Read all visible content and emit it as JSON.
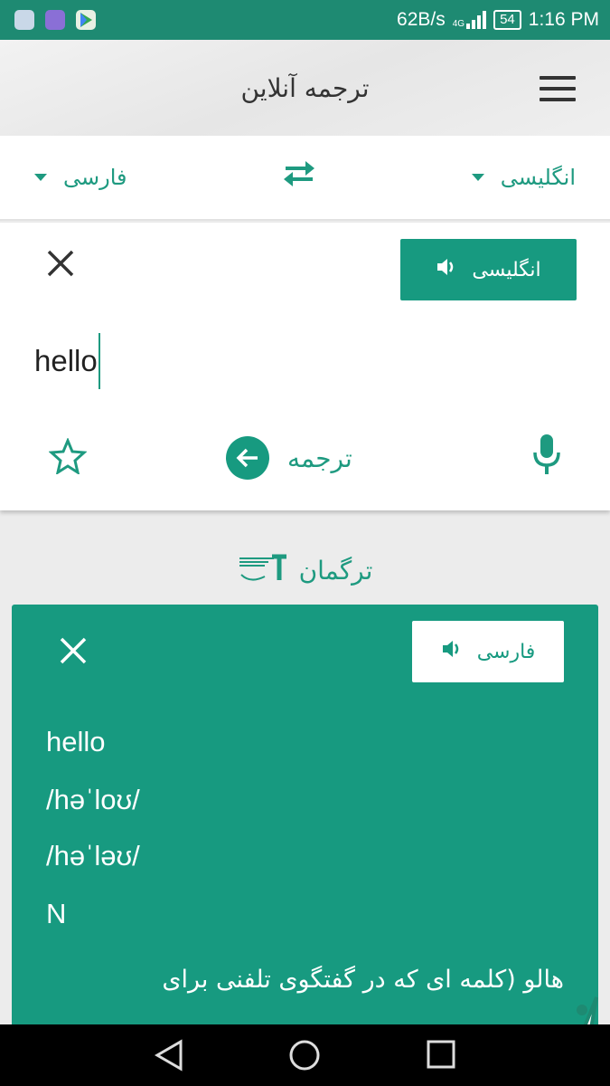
{
  "status_bar": {
    "net_speed": "62B/s",
    "network_type": "4G",
    "battery": "54",
    "time": "1:16 PM"
  },
  "header": {
    "title": "ترجمه آنلاین",
    "menu_icon": "hamburger-menu-icon"
  },
  "language_bar": {
    "left_language": "فارسی",
    "right_language": "انگلیسی",
    "swap_icon": "swap-arrows-icon"
  },
  "input_card": {
    "source_language_button": "انگلیسی",
    "input_text": "hello",
    "translate_label": "ترجمه"
  },
  "brand": {
    "name": "ترگمان"
  },
  "result_card": {
    "target_language_button": "فارسی",
    "lines": [
      "hello",
      "/həˈloʊ/",
      "/həˈləʊ/",
      "N"
    ],
    "persian_text": "هالو (کلمه ای که در گفتگوی تلفنی برای"
  },
  "colors": {
    "accent": "#179a80",
    "status_bar": "#1e8a72",
    "background": "#ececec"
  }
}
